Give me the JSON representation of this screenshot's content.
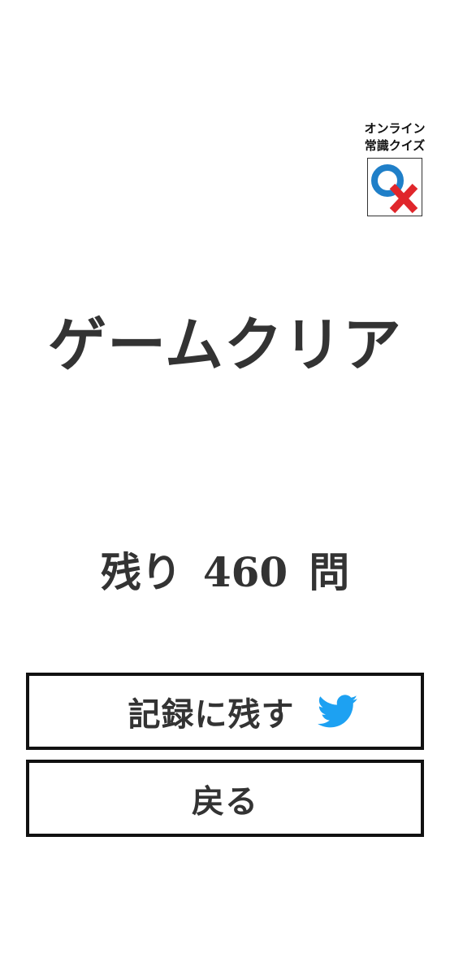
{
  "logo": {
    "line1": "オンライン",
    "line2": "常識クイズ",
    "circle_color": "#1f7fc8",
    "cross_color": "#e0262b"
  },
  "result": {
    "title": "ゲームクリア",
    "remaining_prefix": "残り",
    "remaining_count": "460",
    "remaining_suffix": "問"
  },
  "buttons": {
    "share_label": "記録に残す",
    "share_icon": "twitter-bird-icon",
    "back_label": "戻る"
  },
  "colors": {
    "text": "#333333",
    "twitter": "#1da1f2",
    "border": "#111111"
  }
}
